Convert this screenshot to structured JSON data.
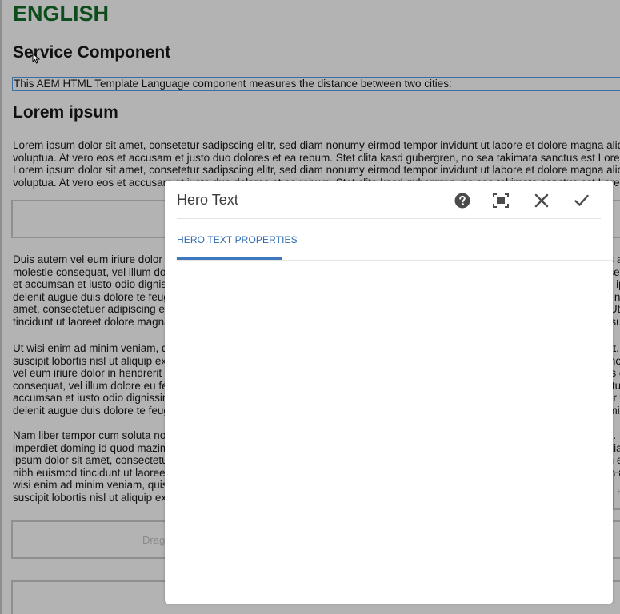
{
  "page": {
    "title": "ENGLISH",
    "service_heading": "Service Component",
    "service_text": "This AEM HTML Template Language component measures the distance between two cities:",
    "lorem_heading": "Lorem ipsum",
    "paragraph1": [
      "Lorem ipsum dolor sit amet, consetetur sadipscing elitr, sed diam nonumy eirmod tempor invidunt ut labore et dolore magna aliquyam erat, sed diam",
      "voluptua. At vero eos et accusam et justo duo dolores et ea rebum. Stet clita kasd gubergren, no sea takimata sanctus est Lorem ipsum dolor sit amet.",
      "Lorem ipsum dolor sit amet, consetetur sadipscing elitr, sed diam nonumy eirmod tempor invidunt ut labore et dolore magna aliquyam erat, sed diam",
      "voluptua. At vero eos et accusam et justo duo dolores et ea rebum. Stet clita kasd gubergren, no sea takimata sanctus est Lorem ipsum dolor sit amet."
    ],
    "paragraph2": [
      "Duis autem vel eum iriure dolor in hendrerit in vulputate velit esse molestie consequat, vel illum dolore eu feugiat nulla facilisis at vero eros et",
      "molestie consequat, vel illum dolore eu feugiat nulla facilisis at vero eros et accumsan et iusto odio dignissim qui blandit praesent luptatum zzril",
      "et accumsan et iusto odio dignissim qui blandit praesent luptatum zzril delenit augue duis dolore te feugait nulla facilisi. Lorem ipsum dolor sit amet, consectetuer",
      "delenit augue duis dolore te feugait nulla facilisi. Lorem ipsum dolor sit amet, consectetuer adipiscing elit, sed diam nonummy nibh euismod tincidunt ut laoreet dolore magna",
      "amet, consectetuer adipiscing elit, sed diam nonummy nibh euismod tincidunt ut laoreet dolore magna aliquam erat volutpat. Ut wisi enim ad minim veniam, quis",
      "tincidunt ut laoreet dolore magna aliquam erat volutpat. Ut wisi enim ad minim veniam, quis nostrud exerci tation ullamcorper suscipit lobortis nisl ut aliquip"
    ],
    "paragraph3": [
      "Ut wisi enim ad minim veniam, quis nostrud exerci tation ullamcorper suscipit lobortis nisl ut aliquip ex ea commodo consequat. Duis autem vel eum iriure",
      "suscipit lobortis nisl ut aliquip ex ea commodo consequat. Duis autem vel eum iriure dolor in hendrerit in vulputate velit esse molestie consequat, vel illum",
      "vel eum iriure dolor in hendrerit in vulputate velit esse molestie consequat, vel illum dolore eu feugiat nulla facilisis at vero eros et accumsan et iusto",
      "consequat, vel illum dolore eu feugiat nulla facilisis at vero eros et accumsan et iusto odio dignissim qui blandit praesent luptatum zzril delenit augue duis",
      "accumsan et iusto odio dignissim qui blandit praesent luptatum zzril delenit augue duis dolore te feugait nulla facilisi. Nam liber tempor cum soluta nobis",
      "delenit augue duis dolore te feugait nulla facilisi. Nam liber tempor cum soluta nobis eleifend option congue nihil imperdiet doming id quod mazim"
    ],
    "paragraph4": [
      "Nam liber tempor cum soluta nobis eleifend option congue nihil imperdiet doming id quod mazim placerat facer possim assum. Lorem ipsum dolor sit amet,",
      "imperdiet doming id quod mazim placerat facer possim assum. Lorem ipsum dolor sit amet, consectetuer adipiscing elit, sed diam nonummy nibh euismod tincidunt",
      "ipsum dolor sit amet, consectetuer adipiscing elit, sed diam nonummy nibh euismod tincidunt ut laoreet dolore magna aliquam erat volutpat. Ut wisi enim ad",
      "nibh euismod tincidunt ut laoreet dolore magna aliquam erat volutpat. Ut wisi enim ad minim veniam, quis nostrud exerci tation ullamcorper suscipit lobortis",
      "wisi enim ad minim veniam, quis nostrud exerci tation ullamcorper suscipit lobortis nisl ut aliquip ex ea commodo consequat.",
      "suscipit lobortis nisl ut aliquip ex ea commodo consequat."
    ],
    "drag_placeholder": "Drag components here",
    "end_placeholder": "End of columns",
    "right_placeholder_fragment": "H"
  },
  "dialog": {
    "title": "Hero Text",
    "tab_label": "HERO TEXT PROPERTIES",
    "icons": {
      "help": "help-circle-icon",
      "fullscreen": "fullscreen-icon",
      "close": "close-icon",
      "done": "checkmark-icon"
    }
  },
  "colors": {
    "overlay": "#b3b3b3",
    "heading_green": "#0d4d1b",
    "accent_blue": "#2d6bb0"
  }
}
